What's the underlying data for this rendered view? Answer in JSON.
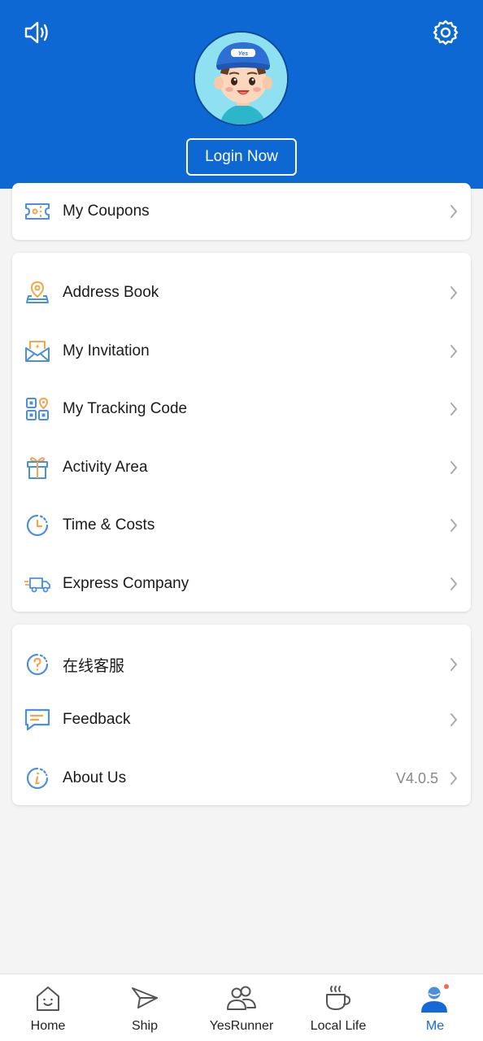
{
  "header": {
    "login_label": "Login Now",
    "cap_text": "Yes"
  },
  "coupons": {
    "label": "My Coupons"
  },
  "services": [
    {
      "label": "Address Book",
      "icon": "address-pin-icon"
    },
    {
      "label": "My Invitation",
      "icon": "invitation-envelope-icon"
    },
    {
      "label": "My Tracking Code",
      "icon": "qr-code-icon"
    },
    {
      "label": "Activity Area",
      "icon": "gift-icon"
    },
    {
      "label": "Time & Costs",
      "icon": "clock-icon"
    },
    {
      "label": "Express Company",
      "icon": "truck-icon"
    }
  ],
  "support": [
    {
      "label": "在线客服",
      "icon": "question-icon"
    },
    {
      "label": "Feedback",
      "icon": "feedback-icon"
    },
    {
      "label": "About Us",
      "icon": "info-icon",
      "value": "V4.0.5"
    }
  ],
  "tabbar": {
    "items": [
      {
        "label": "Home",
        "icon": "home-icon"
      },
      {
        "label": "Ship",
        "icon": "paper-plane-icon"
      },
      {
        "label": "YesRunner",
        "icon": "runner-users-icon"
      },
      {
        "label": "Local Life",
        "icon": "coffee-cup-icon"
      },
      {
        "label": "Me",
        "icon": "me-user-icon",
        "active": true
      }
    ]
  },
  "colors": {
    "brand_blue": "#0d68d3",
    "icon_blue": "#4b8fe0",
    "icon_orange": "#f3a64a",
    "active_tab": "#1569d6",
    "notification_dot": "#f26b4e"
  }
}
